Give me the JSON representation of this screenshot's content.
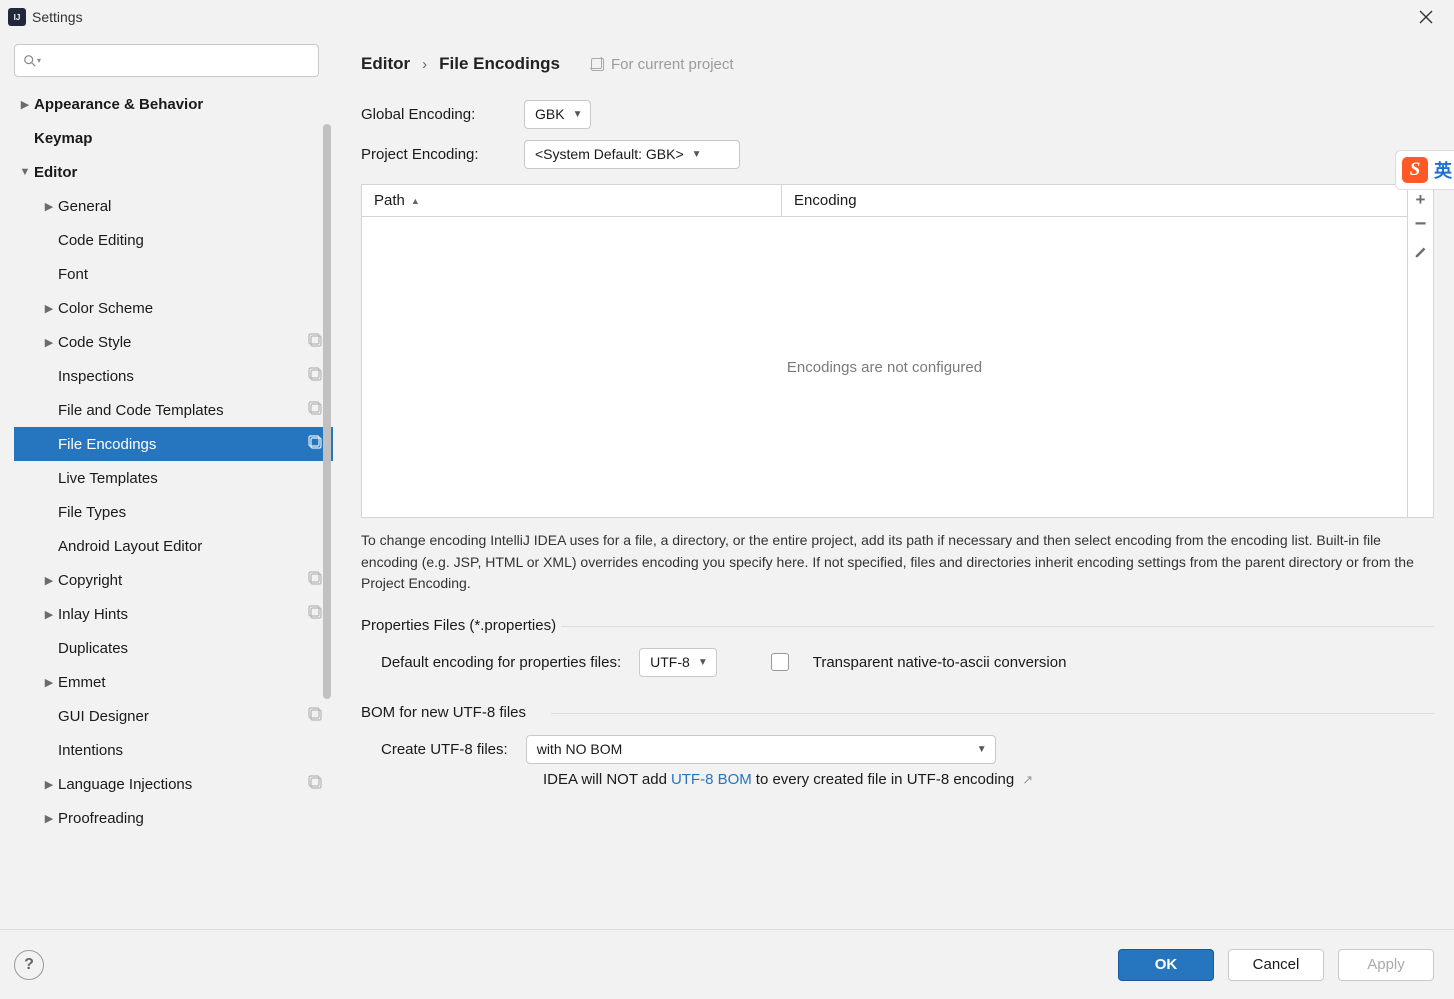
{
  "window": {
    "title": "Settings"
  },
  "search": {
    "placeholder": ""
  },
  "sidebar": {
    "items": [
      {
        "label": "Appearance & Behavior",
        "bold": true,
        "expand": "right",
        "level": 0
      },
      {
        "label": "Keymap",
        "bold": true,
        "level": 0
      },
      {
        "label": "Editor",
        "bold": true,
        "expand": "down",
        "level": 0
      },
      {
        "label": "General",
        "expand": "right",
        "level": 1
      },
      {
        "label": "Code Editing",
        "level": 1
      },
      {
        "label": "Font",
        "level": 1
      },
      {
        "label": "Color Scheme",
        "expand": "right",
        "level": 1
      },
      {
        "label": "Code Style",
        "expand": "right",
        "level": 1,
        "proj": true
      },
      {
        "label": "Inspections",
        "level": 1,
        "proj": true
      },
      {
        "label": "File and Code Templates",
        "level": 1,
        "proj": true
      },
      {
        "label": "File Encodings",
        "level": 1,
        "proj": true,
        "selected": true
      },
      {
        "label": "Live Templates",
        "level": 1
      },
      {
        "label": "File Types",
        "level": 1
      },
      {
        "label": "Android Layout Editor",
        "level": 1
      },
      {
        "label": "Copyright",
        "expand": "right",
        "level": 1,
        "proj": true
      },
      {
        "label": "Inlay Hints",
        "expand": "right",
        "level": 1,
        "proj": true
      },
      {
        "label": "Duplicates",
        "level": 1
      },
      {
        "label": "Emmet",
        "expand": "right",
        "level": 1
      },
      {
        "label": "GUI Designer",
        "level": 1,
        "proj": true
      },
      {
        "label": "Intentions",
        "level": 1
      },
      {
        "label": "Language Injections",
        "expand": "right",
        "level": 1,
        "proj": true
      },
      {
        "label": "Proofreading",
        "expand": "right",
        "level": 1
      }
    ]
  },
  "breadcrumb": {
    "root": "Editor",
    "leaf": "File Encodings"
  },
  "forProject": "For current project",
  "globalEncoding": {
    "label": "Global Encoding:",
    "value": "GBK"
  },
  "projectEncoding": {
    "label": "Project Encoding:",
    "value": "<System Default: GBK>"
  },
  "table": {
    "col_path": "Path",
    "col_encoding": "Encoding",
    "empty": "Encodings are not configured"
  },
  "helpText": "To change encoding IntelliJ IDEA uses for a file, a directory, or the entire project, add its path if necessary and then select encoding from the encoding list. Built-in file encoding (e.g. JSP, HTML or XML) overrides encoding you specify here. If not specified, files and directories inherit encoding settings from the parent directory or from the Project Encoding.",
  "properties": {
    "title": "Properties Files (*.properties)",
    "defaultLabel": "Default encoding for properties files:",
    "defaultValue": "UTF-8",
    "transparentLabel": "Transparent native-to-ascii conversion"
  },
  "bom": {
    "title": "BOM for new UTF-8 files",
    "createLabel": "Create UTF-8 files:",
    "createValue": "with NO BOM",
    "note_pre": "IDEA will NOT add ",
    "note_link": "UTF-8 BOM",
    "note_post": " to every created file in UTF-8 encoding"
  },
  "buttons": {
    "ok": "OK",
    "cancel": "Cancel",
    "apply": "Apply"
  },
  "sogou": {
    "char": "英"
  }
}
